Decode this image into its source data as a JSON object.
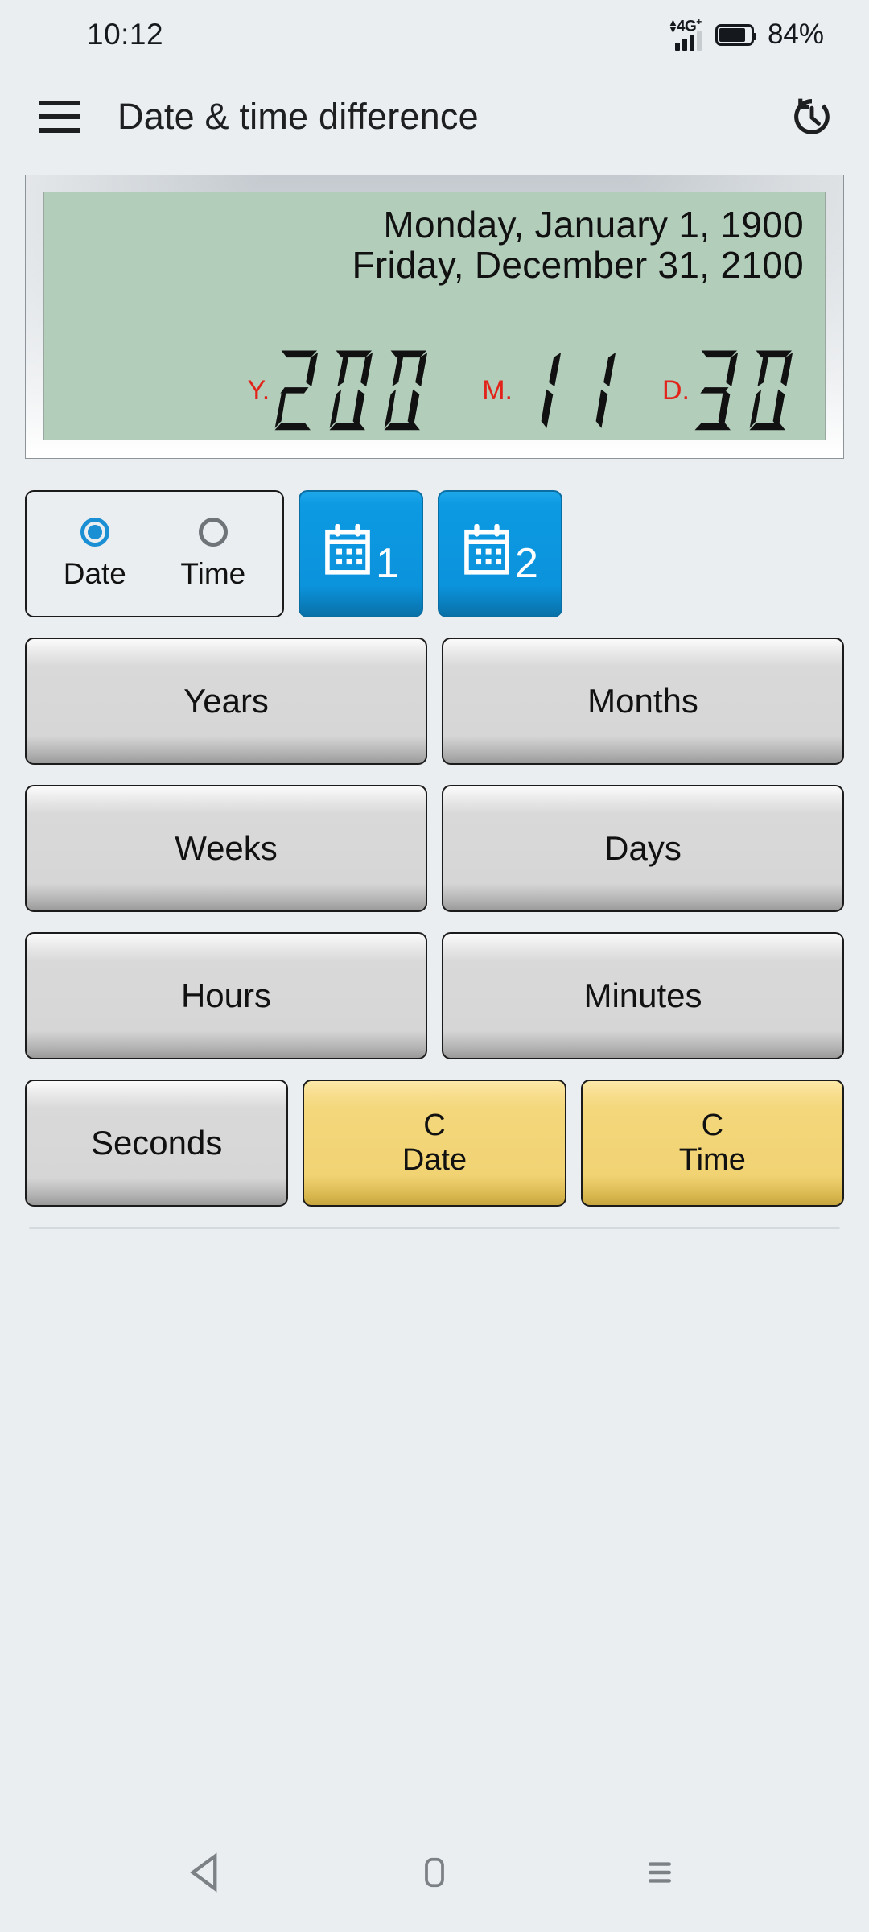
{
  "status_bar": {
    "time": "10:12",
    "network_label": "4G",
    "network_plus": "+",
    "battery_percent": "84%"
  },
  "app_bar": {
    "menu_icon": "hamburger-menu-icon",
    "title": "Date & time difference",
    "history_icon": "history-icon"
  },
  "display": {
    "date_from": "Monday, January 1, 1900",
    "date_to": "Friday, December 31, 2100",
    "segments": [
      {
        "label": "Y.",
        "value": "200"
      },
      {
        "label": "M.",
        "value": "11"
      },
      {
        "label": "D.",
        "value": "30"
      }
    ],
    "screen_color": "#b3cdbb",
    "label_color": "#e2231a",
    "digit_color": "#111111"
  },
  "mode_selector": {
    "options": [
      {
        "label": "Date",
        "selected": true
      },
      {
        "label": "Time",
        "selected": false
      }
    ]
  },
  "date_buttons": [
    {
      "icon": "calendar-icon",
      "number": "1",
      "color": "#0b93dc"
    },
    {
      "icon": "calendar-icon",
      "number": "2",
      "color": "#0b93dc"
    }
  ],
  "unit_buttons": [
    {
      "label": "Years"
    },
    {
      "label": "Months"
    },
    {
      "label": "Weeks"
    },
    {
      "label": "Days"
    },
    {
      "label": "Hours"
    },
    {
      "label": "Minutes"
    },
    {
      "label": "Seconds"
    }
  ],
  "clear_buttons": [
    {
      "line1": "C",
      "line2": "Date",
      "color": "#f3d77a"
    },
    {
      "line1": "C",
      "line2": "Time",
      "color": "#f3d77a"
    }
  ],
  "nav_bar": {
    "back_icon": "back-triangle-icon",
    "home_icon": "home-square-icon",
    "recents_icon": "recents-lines-icon"
  }
}
